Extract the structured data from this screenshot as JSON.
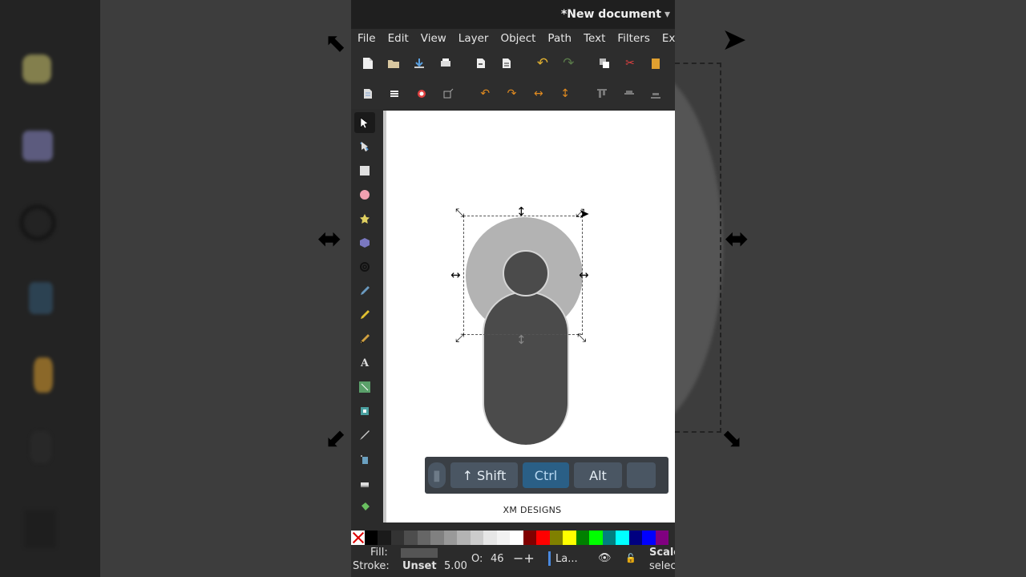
{
  "window": {
    "title": "*New document"
  },
  "menu": [
    "File",
    "Edit",
    "View",
    "Layer",
    "Object",
    "Path",
    "Text",
    "Filters",
    "Ext"
  ],
  "toolbar_row1": [
    "new-document-icon",
    "open-icon",
    "save-icon",
    "print-icon",
    "import-icon",
    "export-icon",
    "undo-icon",
    "redo-icon",
    "duplicate-icon",
    "cut-icon",
    "paste-icon"
  ],
  "toolbar_row2": [
    "document-properties-icon",
    "layers-icon",
    "fill-stroke-icon",
    "transform-icon",
    "rotate-ccw-icon",
    "rotate-cw-icon",
    "flip-horizontal-icon",
    "flip-vertical-icon",
    "align-top-icon",
    "align-middle-icon",
    "align-bottom-icon"
  ],
  "tools": [
    "selector-tool",
    "node-tool",
    "rectangle-tool",
    "ellipse-tool",
    "star-tool",
    "3dbox-tool",
    "spiral-tool",
    "pencil-tool",
    "pen-tool",
    "calligraphy-tool",
    "text-tool",
    "gradient-tool",
    "mesh-tool",
    "dropper-tool",
    "spray-tool",
    "eraser-tool",
    "paint-bucket-tool"
  ],
  "keys": {
    "shift": "↑  Shift",
    "ctrl": "Ctrl",
    "alt": "Alt",
    "blank": ""
  },
  "watermark": "XM DESIGNS",
  "palette": [
    "none",
    "#000000",
    "#1a1a1a",
    "#333333",
    "#4d4d4d",
    "#666666",
    "#808080",
    "#999999",
    "#b3b3b3",
    "#cccccc",
    "#e6e6e6",
    "#f2f2f2",
    "#ffffff",
    "#800000",
    "#ff0000",
    "#808000",
    "#ffff00",
    "#008000",
    "#00ff00",
    "#008080",
    "#00ffff",
    "#000080",
    "#0000ff",
    "#800080"
  ],
  "status": {
    "fill_label": "Fill:",
    "stroke_label": "Stroke:",
    "stroke_value": "Unset",
    "stroke_width": "5.00",
    "opacity_label": "O:",
    "opacity_value": "46",
    "layer_label": "La...",
    "scale_label": "Scale",
    "select_label": "selec"
  }
}
